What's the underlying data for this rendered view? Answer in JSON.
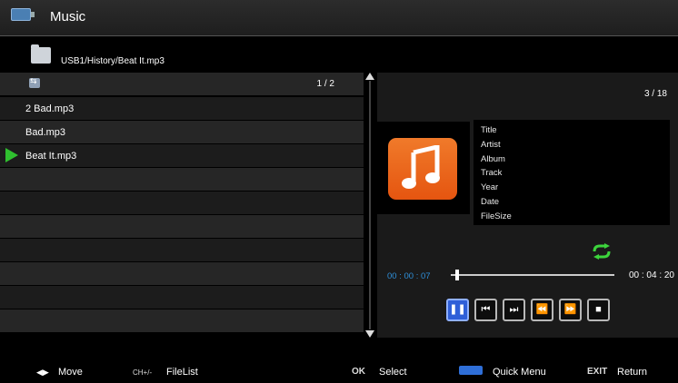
{
  "header": {
    "title": "Music",
    "icon": "usb-icon"
  },
  "path": {
    "text": "USB1/History/Beat It.mp3",
    "icon": "folder-icon"
  },
  "file_list": {
    "page": "1 / 2",
    "items": [
      {
        "label": "2 Bad.mp3"
      },
      {
        "label": "Bad.mp3"
      },
      {
        "label": "Beat It.mp3",
        "playing": true
      }
    ]
  },
  "info_panel": {
    "count": "3 / 18",
    "meta": [
      "Title",
      "Artist",
      "Album",
      "Track",
      "Year",
      "Date",
      "FileSize"
    ]
  },
  "player": {
    "elapsed": "00 : 00 : 07",
    "total": "00 : 04 : 20",
    "progress_fraction": 0.027,
    "controls": [
      {
        "name": "pause-button",
        "glyph": "❚❚",
        "active": true
      },
      {
        "name": "previous-button",
        "glyph": "⏮"
      },
      {
        "name": "next-button",
        "glyph": "⏭"
      },
      {
        "name": "rewind-button",
        "glyph": "⏪"
      },
      {
        "name": "fast-forward-button",
        "glyph": "⏩"
      },
      {
        "name": "stop-button",
        "glyph": "■"
      }
    ]
  },
  "footer": {
    "move_arrows": "◀▶",
    "move_label": "Move",
    "ch_key": "CH+/-",
    "filelist_label": "FileList",
    "ok_key": "OK",
    "select_label": "Select",
    "quick_menu_label": "Quick Menu",
    "exit_key": "EXIT",
    "return_label": "Return"
  },
  "colors": {
    "accent_blue": "#2f5fd8",
    "time_blue": "#2f8fd8",
    "play_green": "#2fbf2f",
    "art_orange": "#f07a2a"
  }
}
